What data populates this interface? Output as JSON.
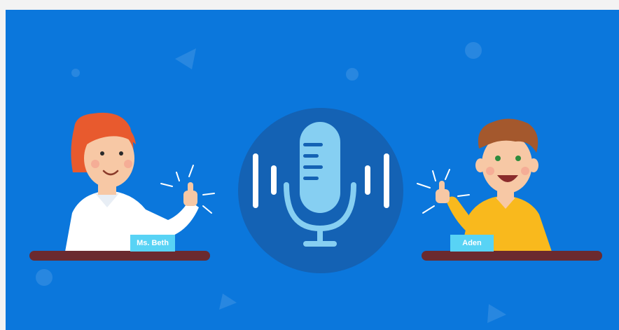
{
  "scene": {
    "left_character": {
      "name_label": "Ms. Beth"
    },
    "right_character": {
      "name_label": "Aden"
    },
    "center_icon": "microphone-icon",
    "colors": {
      "background": "#0b77dc",
      "circle": "#1462b4",
      "microphone": "#86cff2",
      "sound_bars": "#ffffff",
      "desk": "#6b2a2f",
      "nameplate": "#58d3f5",
      "beth_hair": "#e85a2e",
      "beth_shirt": "#ffffff",
      "aden_hair": "#a4582d",
      "aden_shirt": "#f9b91d",
      "skin": "#f7c8a5"
    }
  }
}
